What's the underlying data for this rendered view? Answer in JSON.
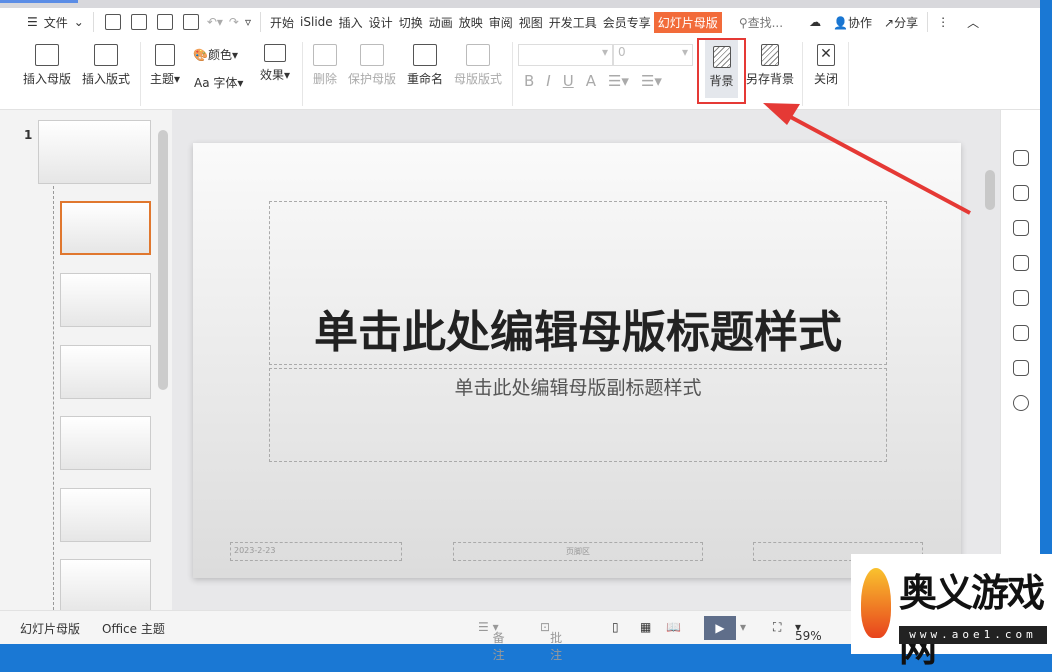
{
  "menubar": {
    "file": "文件",
    "tabs": [
      "开始",
      "iSlide",
      "插入",
      "设计",
      "切换",
      "动画",
      "放映",
      "审阅",
      "视图",
      "开发工具",
      "会员专享"
    ],
    "active_tab": "幻灯片母版",
    "search": "查找...",
    "collab": "协作",
    "share": "分享"
  },
  "ribbon": {
    "insert_master": "插入母版",
    "insert_layout": "插入版式",
    "theme": "主题",
    "color": "颜色",
    "font": "字体",
    "font_prefix": "Aa",
    "effect": "效果",
    "delete": "删除",
    "protect_master": "保护母版",
    "rename": "重命名",
    "master_layout": "母版版式",
    "font_size": "0",
    "bold": "B",
    "italic": "I",
    "underline": "U",
    "font_color": "A",
    "background": "背景",
    "save_background": "另存背景",
    "close": "关闭"
  },
  "highlight_color": "#e53935",
  "thumbnails": {
    "slide_number": "1",
    "count": 7
  },
  "slide": {
    "title": "单击此处编辑母版标题样式",
    "subtitle": "单击此处编辑母版副标题样式",
    "date": "2023-2-23",
    "footer": "页脚区"
  },
  "status": {
    "mode": "幻灯片母版",
    "theme": "Office 主题",
    "notes": "备注",
    "comment": "批注",
    "zoom": "59%"
  },
  "watermark": {
    "logo_text": "奥义游戏网",
    "logo_url": "www.aoe1.com"
  }
}
